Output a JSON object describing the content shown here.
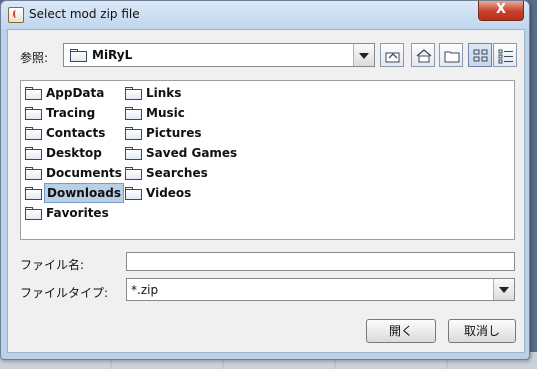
{
  "window": {
    "title": "Select mod zip file",
    "close_glyph": "X"
  },
  "look_in": {
    "label": "参照:",
    "value": "MiRyL"
  },
  "toolbar": {
    "icons": [
      "up-folder-icon",
      "home-icon",
      "new-folder-icon",
      "list-view-icon",
      "details-view-icon"
    ]
  },
  "files": {
    "col1": [
      "AppData",
      "Tracing",
      "Contacts",
      "Desktop",
      "Documents",
      "Downloads",
      "Favorites"
    ],
    "col2": [
      "Links",
      "Music",
      "Pictures",
      "Saved Games",
      "Searches",
      "Videos"
    ],
    "selected": "Downloads"
  },
  "file_name": {
    "label": "ファイル名:",
    "value": ""
  },
  "file_type": {
    "label": "ファイルタイプ:",
    "value": "*.zip"
  },
  "buttons": {
    "open": "開く",
    "cancel": "取消し"
  },
  "colors": {
    "selection": "#b8cfe5",
    "close": "#c7412a",
    "frame": "#b9d1ea"
  }
}
